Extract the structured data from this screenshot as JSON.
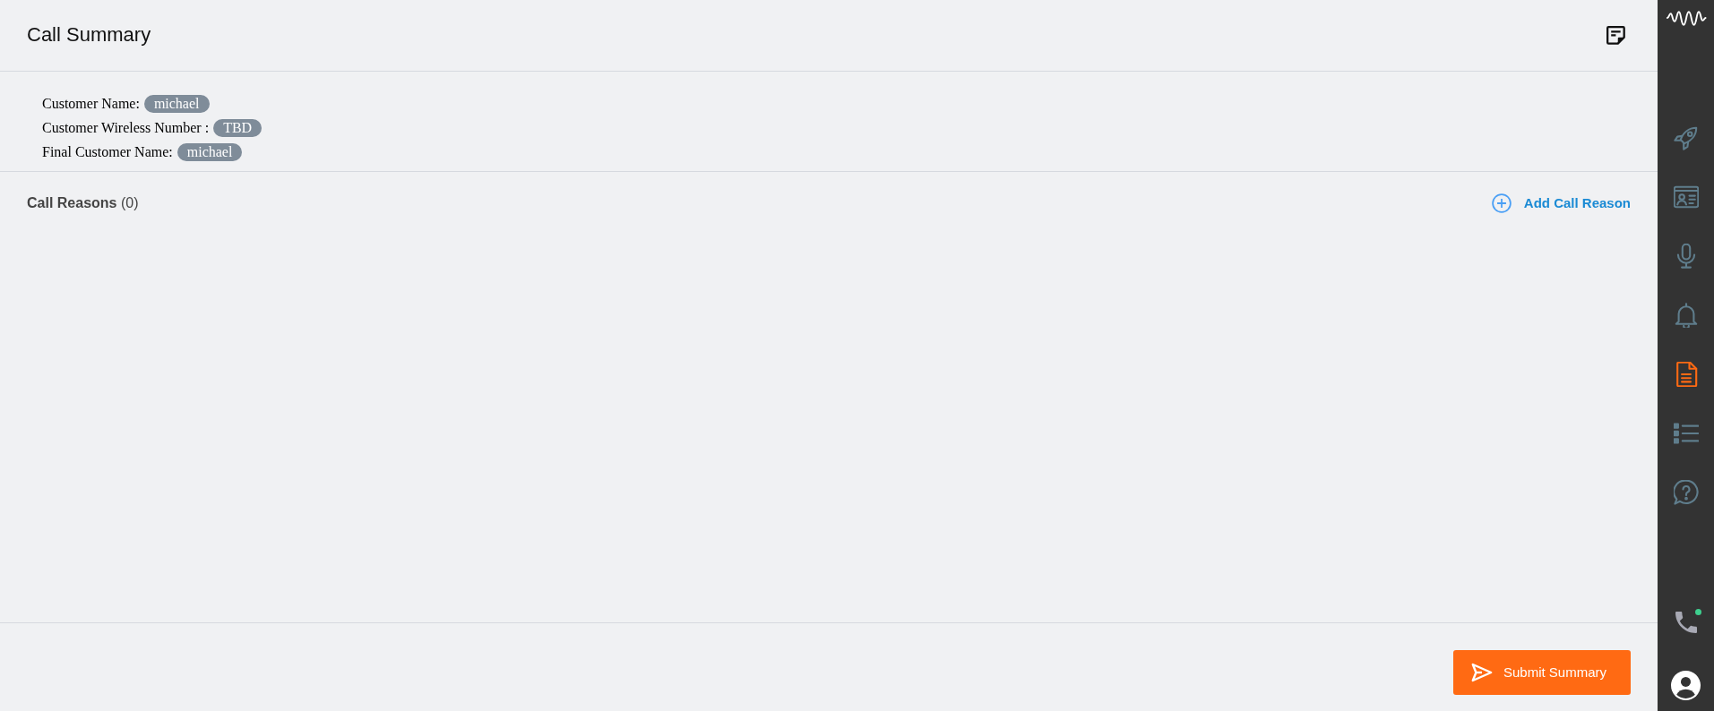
{
  "header": {
    "title": "Call Summary"
  },
  "customer_info": [
    {
      "label": "Customer Name:",
      "value": "michael"
    },
    {
      "label": "Customer Wireless Number :",
      "value": "TBD"
    },
    {
      "label": "Final Customer Name:",
      "value": "michael"
    }
  ],
  "call_reasons": {
    "heading": "**Call Reasons** (0)",
    "add_button": "Add Call Reason"
  },
  "footer": {
    "submit_button": "Submit Summary"
  },
  "sidebar": {
    "items": [
      {
        "selected": false
      },
      {
        "selected": false
      },
      {
        "selected": false
      },
      {
        "selected": false
      },
      {
        "selected": true
      },
      {
        "selected": false
      },
      {
        "selected": false
      }
    ],
    "phone": {
      "online": true
    }
  }
}
